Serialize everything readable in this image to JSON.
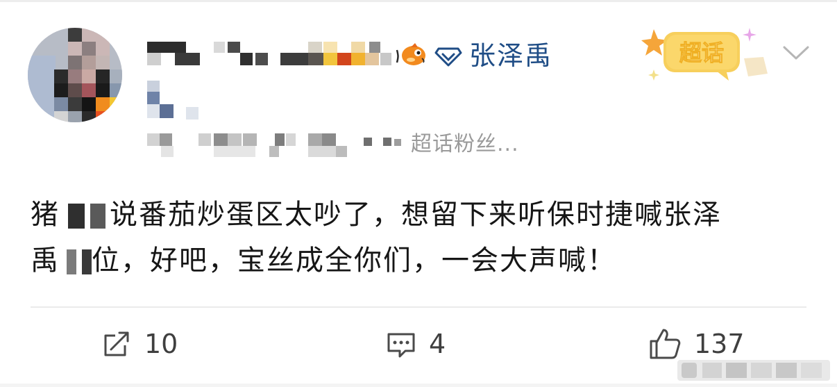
{
  "post": {
    "topic_name": "张泽禹",
    "source_suffix": "超话粉丝...",
    "supertopic_badge": "超话",
    "body_seg1": "猪",
    "body_seg2": "说番茄炒蛋区太吵了，想留下来听保时捷喊张泽",
    "body_seg3": "禹",
    "body_seg4": "位，好吧，宝丝成全你们，一会大声喊！"
  },
  "actions": {
    "repost_count": "10",
    "comment_count": "4",
    "like_count": "137"
  },
  "colors": {
    "topic_blue": "#1f4d86",
    "badge_yellow": "#f5c64a",
    "muted_gray": "#9a9a9a"
  }
}
